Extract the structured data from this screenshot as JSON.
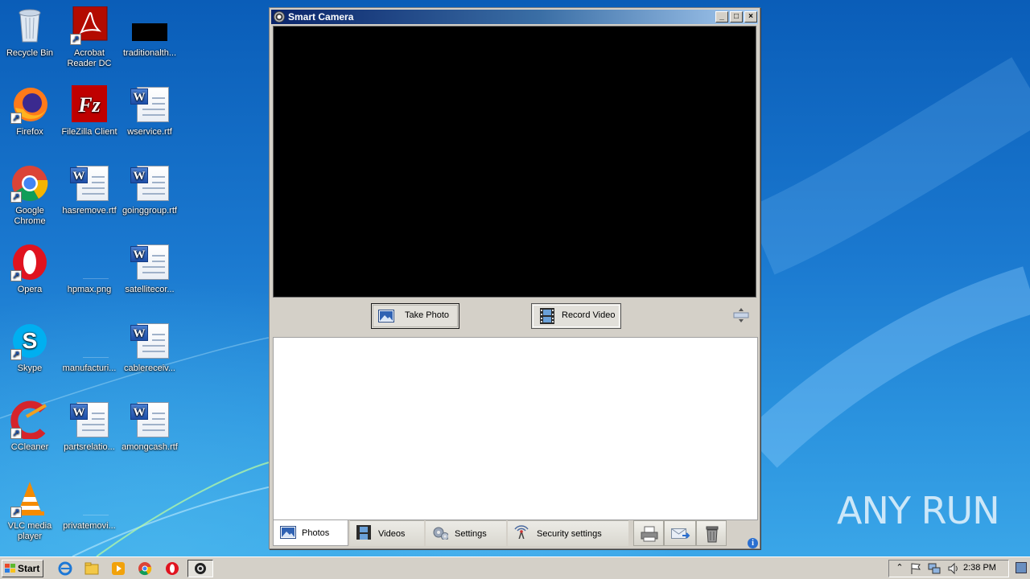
{
  "desktop": {
    "icons": [
      {
        "label": "Recycle Bin",
        "icon": "recycle-bin-icon"
      },
      {
        "label": "Acrobat Reader DC",
        "icon": "acrobat-icon"
      },
      {
        "label": "traditionalth...",
        "icon": "image-file-icon"
      },
      {
        "label": "Firefox",
        "icon": "firefox-icon"
      },
      {
        "label": "FileZilla Client",
        "icon": "filezilla-icon"
      },
      {
        "label": "wservice.rtf",
        "icon": "word-doc-icon"
      },
      {
        "label": "Google Chrome",
        "icon": "chrome-icon"
      },
      {
        "label": "hasremove.rtf",
        "icon": "word-doc-icon"
      },
      {
        "label": "goinggroup.rtf",
        "icon": "word-doc-icon"
      },
      {
        "label": "Opera",
        "icon": "opera-icon"
      },
      {
        "label": "hpmax.png",
        "icon": "image-file-icon"
      },
      {
        "label": "satellitecor...",
        "icon": "word-doc-icon"
      },
      {
        "label": "Skype",
        "icon": "skype-icon"
      },
      {
        "label": "manufacturi...",
        "icon": "image-file-icon"
      },
      {
        "label": "cablereceiv...",
        "icon": "word-doc-icon"
      },
      {
        "label": "CCleaner",
        "icon": "ccleaner-icon"
      },
      {
        "label": "partsrelatio...",
        "icon": "word-doc-icon"
      },
      {
        "label": "amongcash.rtf",
        "icon": "word-doc-icon"
      },
      {
        "label": "VLC media player",
        "icon": "vlc-icon"
      },
      {
        "label": "privatemovi...",
        "icon": "image-file-icon"
      }
    ],
    "watermark": "ANY RUN"
  },
  "window": {
    "title": "Smart Camera",
    "minimize": "_",
    "maximize": "□",
    "close": "×",
    "take_photo": "Take Photo",
    "record_video": "Record Video",
    "tabs": [
      "Photos",
      "Videos",
      "Settings",
      "Security settings"
    ],
    "info": "i"
  },
  "taskbar": {
    "start": "Start",
    "tray_chevron": "⌃",
    "clock": "2:38 PM"
  },
  "colors": {
    "titlebar_start": "#0a246a",
    "titlebar_end": "#a6caf0",
    "window_bg": "#d4d0c8",
    "video_bg": "#000000"
  }
}
